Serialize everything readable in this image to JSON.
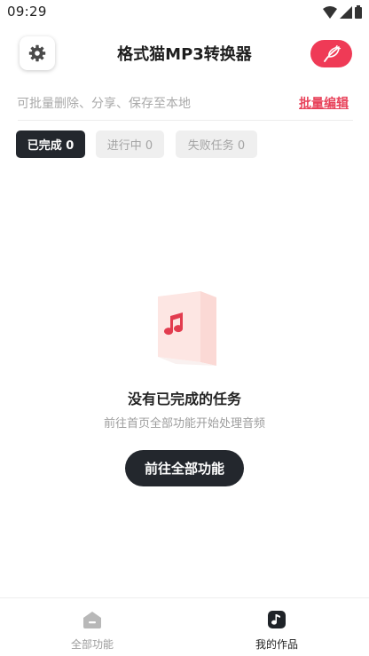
{
  "status_bar": {
    "time": "09:29"
  },
  "header": {
    "title": "格式猫MP3转换器",
    "settings_icon": "gear-icon",
    "feather_icon": "feather-icon",
    "feather_color": "#ef3a56"
  },
  "hint": {
    "text": "可批量删除、分享、保存至本地",
    "batch_edit": "批量编辑"
  },
  "tabs": [
    {
      "label": "已完成 0",
      "active": true
    },
    {
      "label": "进行中 0",
      "active": false
    },
    {
      "label": "失败任务 0",
      "active": false
    }
  ],
  "empty_state": {
    "icon": "music-note-icon",
    "title": "没有已完成的任务",
    "subtitle": "前往首页全部功能开始处理音频",
    "button": "前往全部功能"
  },
  "bottom_nav": [
    {
      "label": "全部功能",
      "icon": "home-icon",
      "active": false
    },
    {
      "label": "我的作品",
      "icon": "music-note-icon",
      "active": true
    }
  ],
  "colors": {
    "accent": "#ef3a56",
    "dark": "#23272d",
    "link": "#e8425a"
  }
}
